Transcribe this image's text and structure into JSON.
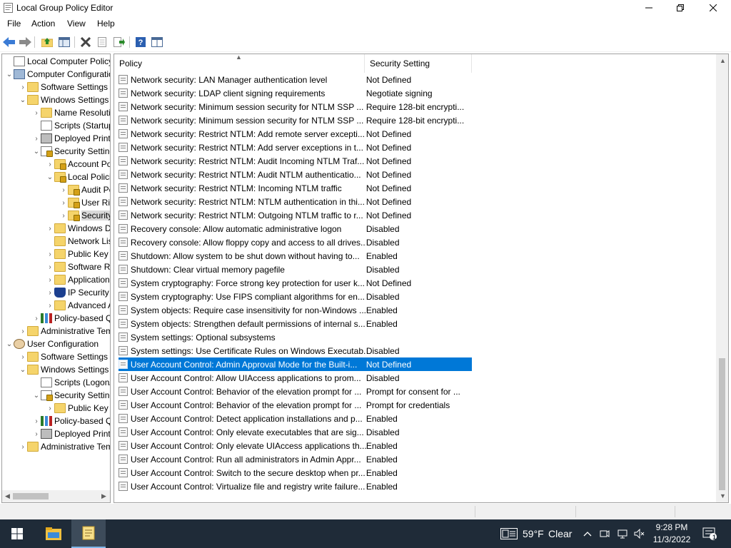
{
  "window": {
    "title": "Local Group Policy Editor",
    "controls": {
      "minimize": "—",
      "maximize": "☐",
      "close": "✕"
    }
  },
  "menu": {
    "file": "File",
    "action": "Action",
    "view": "View",
    "help": "Help"
  },
  "toolbar": {
    "icons": [
      "back-arrow-icon",
      "forward-arrow-icon",
      "up-folder-icon",
      "show-hide-tree-icon",
      "delete-icon",
      "properties-icon",
      "export-list-icon",
      "help-icon",
      "extended-view-icon"
    ]
  },
  "tree": {
    "items": [
      {
        "label": "Local Computer Policy",
        "icon": "doc"
      },
      {
        "label": "Computer Configuration",
        "icon": "pc"
      },
      {
        "label": "Software Settings",
        "icon": "folder"
      },
      {
        "label": "Windows Settings",
        "icon": "folder"
      },
      {
        "label": "Name Resolution Policy",
        "icon": "folder"
      },
      {
        "label": "Scripts (Startup/Shutdown)",
        "icon": "doc"
      },
      {
        "label": "Deployed Printers",
        "icon": "printer"
      },
      {
        "label": "Security Settings",
        "icon": "lock"
      },
      {
        "label": "Account Policies",
        "icon": "folder-lock"
      },
      {
        "label": "Local Policies",
        "icon": "folder-lock"
      },
      {
        "label": "Audit Policy",
        "icon": "folder-lock"
      },
      {
        "label": "User Rights Assignment",
        "icon": "folder-lock"
      },
      {
        "label": "Security Options",
        "icon": "folder-lock"
      },
      {
        "label": "Windows Defender Firewall",
        "icon": "folder"
      },
      {
        "label": "Network List Manager",
        "icon": "folder"
      },
      {
        "label": "Public Key Policies",
        "icon": "folder"
      },
      {
        "label": "Software Restriction Policies",
        "icon": "folder"
      },
      {
        "label": "Application Control Policies",
        "icon": "folder"
      },
      {
        "label": "IP Security Policies",
        "icon": "shield"
      },
      {
        "label": "Advanced Audit Policy",
        "icon": "folder"
      },
      {
        "label": "Policy-based QoS",
        "icon": "chart"
      },
      {
        "label": "Administrative Templates",
        "icon": "folder"
      },
      {
        "label": "User Configuration",
        "icon": "user"
      },
      {
        "label": "Software Settings",
        "icon": "folder"
      },
      {
        "label": "Windows Settings",
        "icon": "folder"
      },
      {
        "label": "Scripts (Logon/Logoff)",
        "icon": "doc"
      },
      {
        "label": "Security Settings",
        "icon": "lock"
      },
      {
        "label": "Public Key Policies",
        "icon": "folder"
      },
      {
        "label": "Policy-based QoS",
        "icon": "chart"
      },
      {
        "label": "Deployed Printers",
        "icon": "printer"
      },
      {
        "label": "Administrative Templates",
        "icon": "folder"
      }
    ]
  },
  "list": {
    "headers": {
      "policy": "Policy",
      "setting": "Security Setting"
    },
    "rows": [
      {
        "policy": "Network security: LAN Manager authentication level",
        "setting": "Not Defined"
      },
      {
        "policy": "Network security: LDAP client signing requirements",
        "setting": "Negotiate signing"
      },
      {
        "policy": "Network security: Minimum session security for NTLM SSP ...",
        "setting": "Require 128-bit encrypti..."
      },
      {
        "policy": "Network security: Minimum session security for NTLM SSP ...",
        "setting": "Require 128-bit encrypti..."
      },
      {
        "policy": "Network security: Restrict NTLM: Add remote server excepti...",
        "setting": "Not Defined"
      },
      {
        "policy": "Network security: Restrict NTLM: Add server exceptions in t...",
        "setting": "Not Defined"
      },
      {
        "policy": "Network security: Restrict NTLM: Audit Incoming NTLM Traf...",
        "setting": "Not Defined"
      },
      {
        "policy": "Network security: Restrict NTLM: Audit NTLM authenticatio...",
        "setting": "Not Defined"
      },
      {
        "policy": "Network security: Restrict NTLM: Incoming NTLM traffic",
        "setting": "Not Defined"
      },
      {
        "policy": "Network security: Restrict NTLM: NTLM authentication in thi...",
        "setting": "Not Defined"
      },
      {
        "policy": "Network security: Restrict NTLM: Outgoing NTLM traffic to r...",
        "setting": "Not Defined"
      },
      {
        "policy": "Recovery console: Allow automatic administrative logon",
        "setting": "Disabled"
      },
      {
        "policy": "Recovery console: Allow floppy copy and access to all drives...",
        "setting": "Disabled"
      },
      {
        "policy": "Shutdown: Allow system to be shut down without having to...",
        "setting": "Enabled"
      },
      {
        "policy": "Shutdown: Clear virtual memory pagefile",
        "setting": "Disabled"
      },
      {
        "policy": "System cryptography: Force strong key protection for user k...",
        "setting": "Not Defined"
      },
      {
        "policy": "System cryptography: Use FIPS compliant algorithms for en...",
        "setting": "Disabled"
      },
      {
        "policy": "System objects: Require case insensitivity for non-Windows ...",
        "setting": "Enabled"
      },
      {
        "policy": "System objects: Strengthen default permissions of internal s...",
        "setting": "Enabled"
      },
      {
        "policy": "System settings: Optional subsystems",
        "setting": ""
      },
      {
        "policy": "System settings: Use Certificate Rules on Windows Executab...",
        "setting": "Disabled"
      },
      {
        "policy": "User Account Control: Admin Approval Mode for the Built-i...",
        "setting": "Not Defined",
        "selected": true
      },
      {
        "policy": "User Account Control: Allow UIAccess applications to prom...",
        "setting": "Disabled"
      },
      {
        "policy": "User Account Control: Behavior of the elevation prompt for ...",
        "setting": "Prompt for consent for ..."
      },
      {
        "policy": "User Account Control: Behavior of the elevation prompt for ...",
        "setting": "Prompt for credentials"
      },
      {
        "policy": "User Account Control: Detect application installations and p...",
        "setting": "Enabled"
      },
      {
        "policy": "User Account Control: Only elevate executables that are sig...",
        "setting": "Disabled"
      },
      {
        "policy": "User Account Control: Only elevate UIAccess applications th...",
        "setting": "Enabled"
      },
      {
        "policy": "User Account Control: Run all administrators in Admin Appr...",
        "setting": "Enabled"
      },
      {
        "policy": "User Account Control: Switch to the secure desktop when pr...",
        "setting": "Enabled"
      },
      {
        "policy": "User Account Control: Virtualize file and registry write failure...",
        "setting": "Enabled"
      }
    ]
  },
  "taskbar": {
    "weather_temp": "59°F",
    "weather_condition": "Clear",
    "clock_time": "9:28 PM",
    "clock_date": "11/3/2022",
    "notification_count": "1"
  },
  "colors": {
    "selection": "#0078d7",
    "taskbar": "#1f2b38"
  }
}
